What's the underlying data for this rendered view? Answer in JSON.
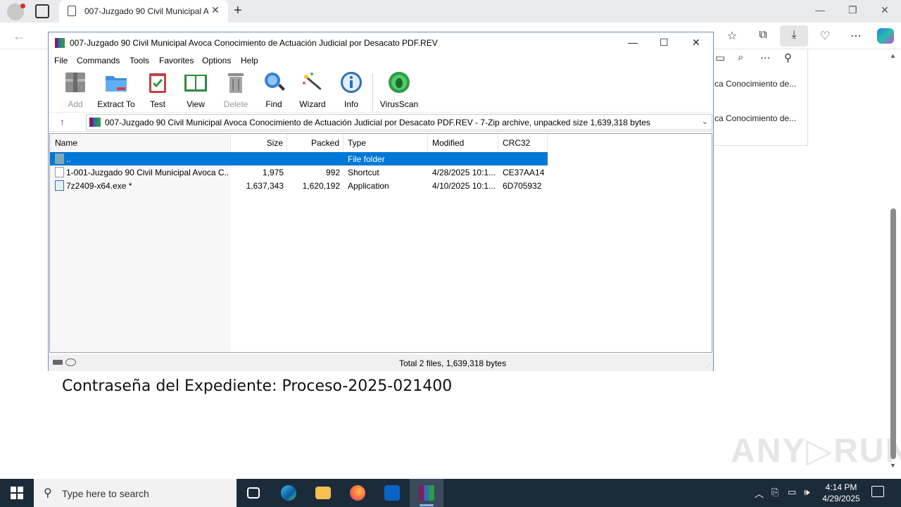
{
  "browser": {
    "tab_title": "007-Juzgado 90 Civil Municipal A",
    "tab_close": "✕",
    "new_tab": "+",
    "downloads_items": [
      "ca Conocimiento de...",
      "ca Conocimiento de..."
    ]
  },
  "document": {
    "password_line": "Contraseña del Expediente: Proceso-2025-021400",
    "watermark": "ANY RUN"
  },
  "winrar": {
    "title": "007-Juzgado 90 Civil Municipal Avoca Conocimiento de Actuación Judicial por Desacato PDF.REV",
    "menu": [
      "File",
      "Commands",
      "Tools",
      "Favorites",
      "Options",
      "Help"
    ],
    "toolbar": [
      {
        "label": "Add",
        "icon": "add-archive-icon",
        "disabled": true
      },
      {
        "label": "Extract To",
        "icon": "extract-folder-icon",
        "disabled": false
      },
      {
        "label": "Test",
        "icon": "test-clipboard-icon",
        "disabled": false
      },
      {
        "label": "View",
        "icon": "view-book-icon",
        "disabled": false
      },
      {
        "label": "Delete",
        "icon": "delete-trash-icon",
        "disabled": true
      },
      {
        "label": "Find",
        "icon": "find-magnifier-icon",
        "disabled": false
      },
      {
        "label": "Wizard",
        "icon": "wizard-wand-icon",
        "disabled": false
      },
      {
        "label": "Info",
        "icon": "info-icon",
        "disabled": false
      },
      {
        "label": "VirusScan",
        "icon": "virusscan-bug-icon",
        "disabled": false
      }
    ],
    "path": "007-Juzgado 90 Civil Municipal Avoca Conocimiento de Actuación Judicial por Desacato PDF.REV - 7-Zip archive, unpacked size 1,639,318 bytes",
    "columns": {
      "name": "Name",
      "size": "Size",
      "packed": "Packed",
      "type": "Type",
      "modified": "Modified",
      "crc": "CRC32"
    },
    "rows": [
      {
        "name": "..",
        "size": "",
        "packed": "",
        "type": "File folder",
        "modified": "",
        "crc": "",
        "selected": true
      },
      {
        "name": "1-001-Juzgado 90 Civil Municipal Avoca C...",
        "size": "1,975",
        "packed": "992",
        "type": "Shortcut",
        "modified": "4/28/2025 10:1...",
        "crc": "CE37AA14",
        "selected": false
      },
      {
        "name": "7z2409-x64.exe *",
        "size": "1,637,343",
        "packed": "1,620,192",
        "type": "Application",
        "modified": "4/10/2025 10:1...",
        "crc": "6D705932",
        "selected": false
      }
    ],
    "status": "Total 2 files, 1,639,318 bytes"
  },
  "taskbar": {
    "search_placeholder": "Type here to search",
    "time": "4:14 PM",
    "date": "4/29/2025"
  },
  "colors": {
    "selection": "#0078d7",
    "taskbar": "#1c2b3a"
  }
}
